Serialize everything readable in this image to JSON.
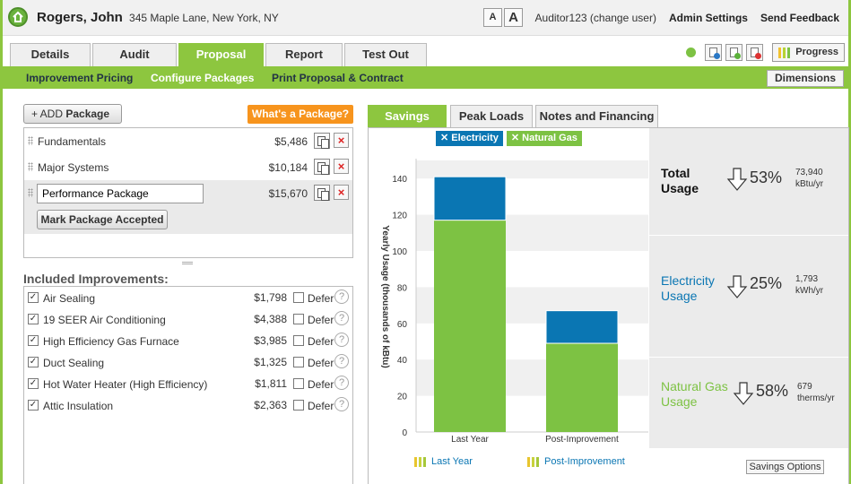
{
  "header": {
    "customer_name": "Rogers, John",
    "customer_address": "345 Maple Lane, New York, NY",
    "font_small": "A",
    "font_large": "A",
    "user": "Auditor123 (change user)",
    "admin_settings": "Admin Settings",
    "send_feedback": "Send Feedback"
  },
  "tabs": [
    {
      "label": "Details"
    },
    {
      "label": "Audit"
    },
    {
      "label": "Proposal",
      "active": true
    },
    {
      "label": "Report"
    },
    {
      "label": "Test Out"
    }
  ],
  "toolbar": {
    "progress_label": "Progress",
    "icons": [
      "green-status-dot",
      "doc-blue-icon",
      "doc-green-icon",
      "doc-red-icon"
    ]
  },
  "subnav": {
    "items": [
      "Improvement Pricing",
      "Configure Packages",
      "Print Proposal & Contract"
    ],
    "active": "Configure Packages",
    "dimensions_label": "Dimensions"
  },
  "packages": {
    "add_prefix": "+ ADD",
    "add_label": "Package",
    "whats_label": "What's a Package?",
    "items": [
      {
        "name": "Fundamentals",
        "price": "$5,486"
      },
      {
        "name": "Major Systems",
        "price": "$10,184"
      },
      {
        "name": "Performance Package",
        "price": "$15,670",
        "selected": true
      }
    ],
    "mark_accepted_label": "Mark Package Accepted"
  },
  "improvements": {
    "title": "Included Improvements:",
    "defer_label": "Defer",
    "help_glyph": "?",
    "items": [
      {
        "name": "Air Sealing",
        "price": "$1,798",
        "checked": true
      },
      {
        "name": "19 SEER Air Conditioning",
        "price": "$4,388",
        "checked": true
      },
      {
        "name": "High Efficiency Gas Furnace",
        "price": "$3,985",
        "checked": true
      },
      {
        "name": "Duct Sealing",
        "price": "$1,325",
        "checked": true
      },
      {
        "name": "Hot Water Heater (High Efficiency)",
        "price": "$1,811",
        "checked": true
      },
      {
        "name": "Attic Insulation",
        "price": "$2,363",
        "checked": true
      }
    ]
  },
  "right_tabs": [
    {
      "label": "Savings",
      "active": true
    },
    {
      "label": "Peak Loads"
    },
    {
      "label": "Notes and Financing"
    }
  ],
  "colors": {
    "brand_green": "#8dc63f",
    "orange": "#f7941d",
    "electricity_blue": "#0a76b3",
    "gas_green": "#7dc243",
    "last_year_yellow": "#c8d23c"
  },
  "chart_data": {
    "type": "bar",
    "stacked": true,
    "categories": [
      "Last Year",
      "Post-Improvement"
    ],
    "series": [
      {
        "name": "Natural Gas",
        "values": [
          117,
          49
        ],
        "color": "#7dc243"
      },
      {
        "name": "Electricity",
        "values": [
          24,
          18
        ],
        "color": "#0a76b3"
      }
    ],
    "ylabel": "Yearly Usage (thousands of kBtu)",
    "ylim": [
      0,
      150
    ],
    "yticks": [
      0,
      20,
      40,
      60,
      80,
      100,
      120,
      140
    ],
    "legend_top": [
      "Electricity",
      "Natural Gas"
    ],
    "legend_top_glyph": "✕",
    "legend_bottom": [
      "Last Year",
      "Post-Improvement"
    ],
    "grid": "alternating bands"
  },
  "stats": {
    "total": {
      "line1": "Total",
      "line2": "Usage",
      "pct": "53%",
      "amount": "73,940",
      "unit": "kBtu/yr"
    },
    "electricity": {
      "line1": "Electricity",
      "line2": "Usage",
      "pct": "25%",
      "amount": "1,793",
      "unit": "kWh/yr"
    },
    "gas": {
      "line1": "Natural Gas",
      "line2": "Usage",
      "pct": "58%",
      "amount": "679",
      "unit": "therms/yr"
    },
    "savings_options_label": "Savings Options"
  }
}
